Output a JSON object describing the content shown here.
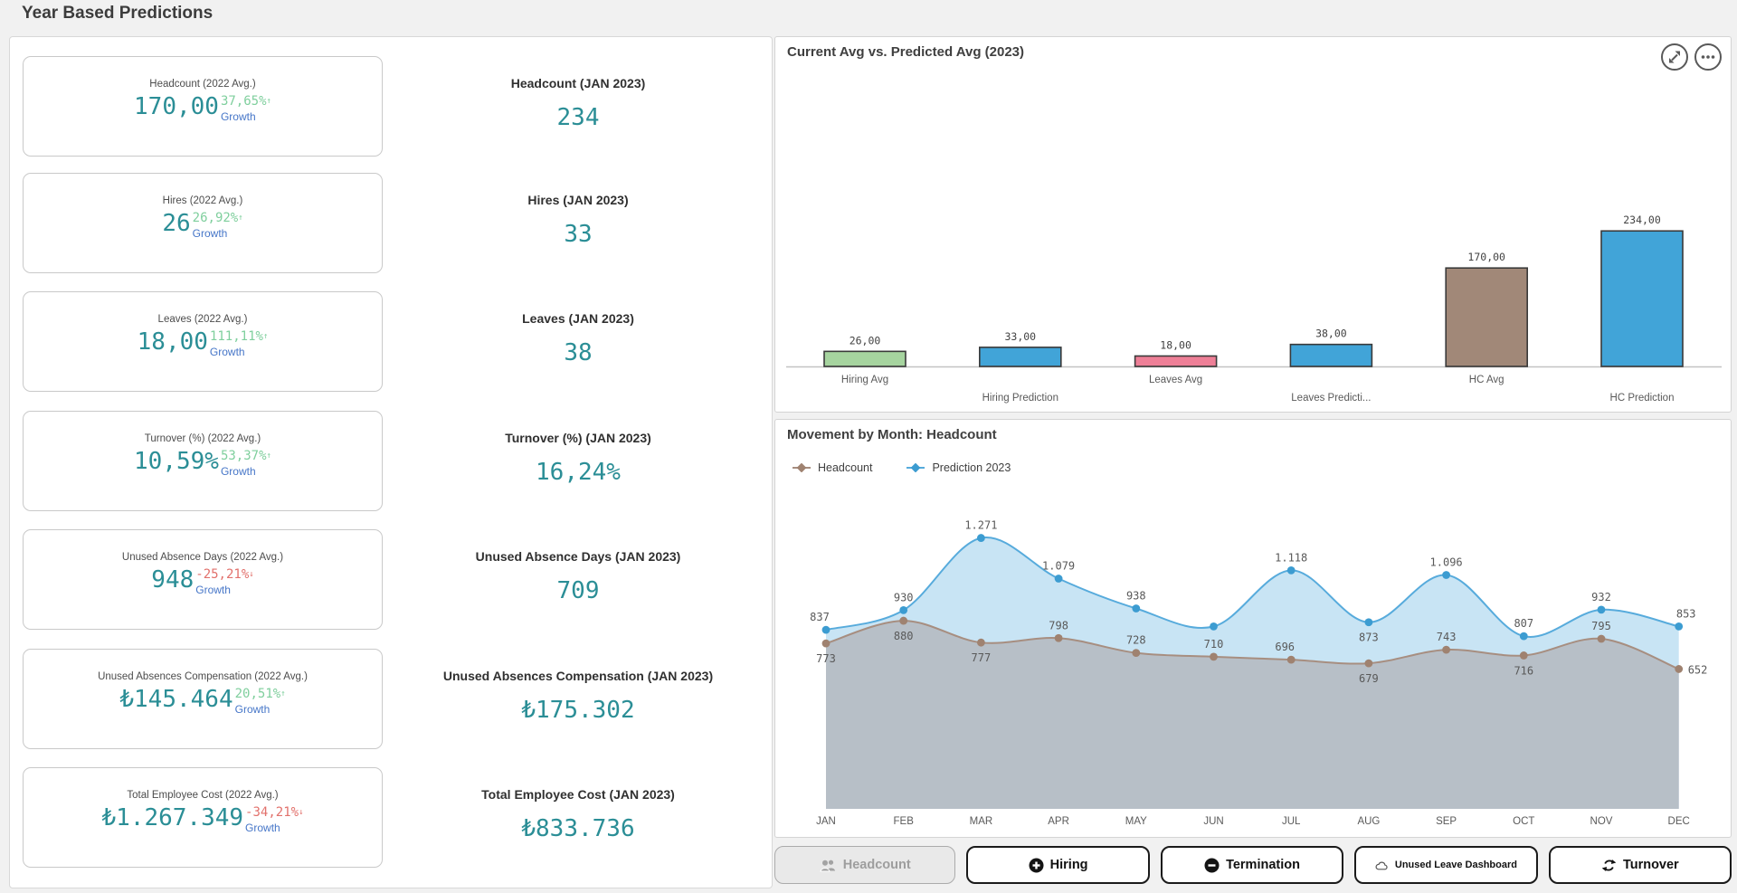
{
  "page": {
    "title": "Year Based Predictions"
  },
  "colors": {
    "value_teal": "#2b8e96",
    "growth_green": "#7fcf9d",
    "growth_red": "#e2716c",
    "growth_blue": "#4676c8"
  },
  "kpis": {
    "rows": [
      {
        "avg_label": "Headcount (2022 Avg.)",
        "avg_value": "170,00",
        "growth_pct": "37,65%",
        "growth_dir": "up",
        "growth_label": "Growth",
        "pred_label": "Headcount (JAN 2023)",
        "pred_value": "234"
      },
      {
        "avg_label": "Hires (2022 Avg.)",
        "avg_value": "26",
        "growth_pct": "26,92%",
        "growth_dir": "up",
        "growth_label": "Growth",
        "pred_label": "Hires (JAN 2023)",
        "pred_value": "33"
      },
      {
        "avg_label": "Leaves (2022 Avg.)",
        "avg_value": "18,00",
        "growth_pct": "111,11%",
        "growth_dir": "up",
        "growth_label": "Growth",
        "pred_label": "Leaves (JAN 2023)",
        "pred_value": "38"
      },
      {
        "avg_label": "Turnover (%) (2022 Avg.)",
        "avg_value": "10,59%",
        "growth_pct": "53,37%",
        "growth_dir": "up",
        "growth_label": "Growth",
        "pred_label": "Turnover (%) (JAN 2023)",
        "pred_value": "16,24%"
      },
      {
        "avg_label": "Unused Absence Days (2022 Avg.)",
        "avg_value": "948",
        "growth_pct": "-25,21%",
        "growth_dir": "down",
        "growth_label": "Growth",
        "pred_label": "Unused Absence Days (JAN 2023)",
        "pred_value": "709"
      },
      {
        "avg_label": "Unused Absences Compensation (2022 Avg.)",
        "avg_value": "₺145.464",
        "growth_pct": "20,51%",
        "growth_dir": "up",
        "growth_label": "Growth",
        "pred_label": "Unused Absences Compensation (JAN 2023)",
        "pred_value": "₺175.302"
      },
      {
        "avg_label": "Total Employee Cost (2022 Avg.)",
        "avg_value": "₺1.267.349",
        "growth_pct": "-34,21%",
        "growth_dir": "down",
        "growth_label": "Growth",
        "pred_label": "Total Employee Cost (JAN 2023)",
        "pred_value": "₺833.736"
      }
    ]
  },
  "chart_data": [
    {
      "type": "bar",
      "title": "Current Avg vs. Predicted Avg (2023)",
      "categories": [
        "Hiring Avg",
        "Hiring Prediction",
        "Leaves Avg",
        "Leaves Predicti...",
        "HC Avg",
        "HC Prediction"
      ],
      "values": [
        26,
        33,
        18,
        38,
        170,
        234
      ],
      "value_labels": [
        "26,00",
        "33,00",
        "18,00",
        "38,00",
        "170,00",
        "234,00"
      ],
      "bar_colors": [
        "#a6d49f",
        "#41a4d8",
        "#ee7f97",
        "#41a4d8",
        "#a18878",
        "#41a4d8"
      ],
      "ylim": [
        0,
        260
      ],
      "grid": false,
      "toolbar_icons": [
        "expand-icon",
        "more-icon"
      ]
    },
    {
      "type": "area",
      "title": "Movement by Month: Headcount",
      "categories": [
        "JAN",
        "FEB",
        "MAR",
        "APR",
        "MAY",
        "JUN",
        "JUL",
        "AUG",
        "SEP",
        "OCT",
        "NOV",
        "DEC"
      ],
      "series": [
        {
          "name": "Headcount",
          "color": "#a78e80",
          "marker": "#9f8270",
          "fill": "#b7bfc7",
          "values": [
            773,
            880,
            777,
            798,
            728,
            710,
            696,
            679,
            743,
            716,
            795,
            652
          ],
          "labels": [
            "773",
            "880",
            "777",
            "798",
            "728",
            "710",
            "696",
            "679",
            "743",
            "716",
            "795",
            "652"
          ]
        },
        {
          "name": "Prediction 2023",
          "color": "#57abdc",
          "marker": "#3c9cd1",
          "fill": "#c8e4f4",
          "values": [
            837,
            930,
            1271,
            1079,
            938,
            853,
            1118,
            873,
            1096,
            807,
            932,
            853
          ],
          "labels": [
            "837",
            "930",
            "1.271",
            "1.079",
            "938",
            "",
            "1.118",
            "873",
            "1.096",
            "807",
            "932",
            "853"
          ]
        }
      ],
      "legend_position": "top-left"
    }
  ],
  "footer_buttons": [
    {
      "label": "Headcount",
      "icon": "people-icon",
      "disabled": true,
      "small_text": false
    },
    {
      "label": "Hiring",
      "icon": "plus-circle-icon",
      "disabled": false,
      "small_text": false
    },
    {
      "label": "Termination",
      "icon": "minus-circle-icon",
      "disabled": false,
      "small_text": false
    },
    {
      "label": "Unused Leave Dashboard",
      "icon": "cloud-icon",
      "disabled": false,
      "small_text": true
    },
    {
      "label": "Turnover",
      "icon": "refresh-icon",
      "disabled": false,
      "small_text": false
    }
  ]
}
